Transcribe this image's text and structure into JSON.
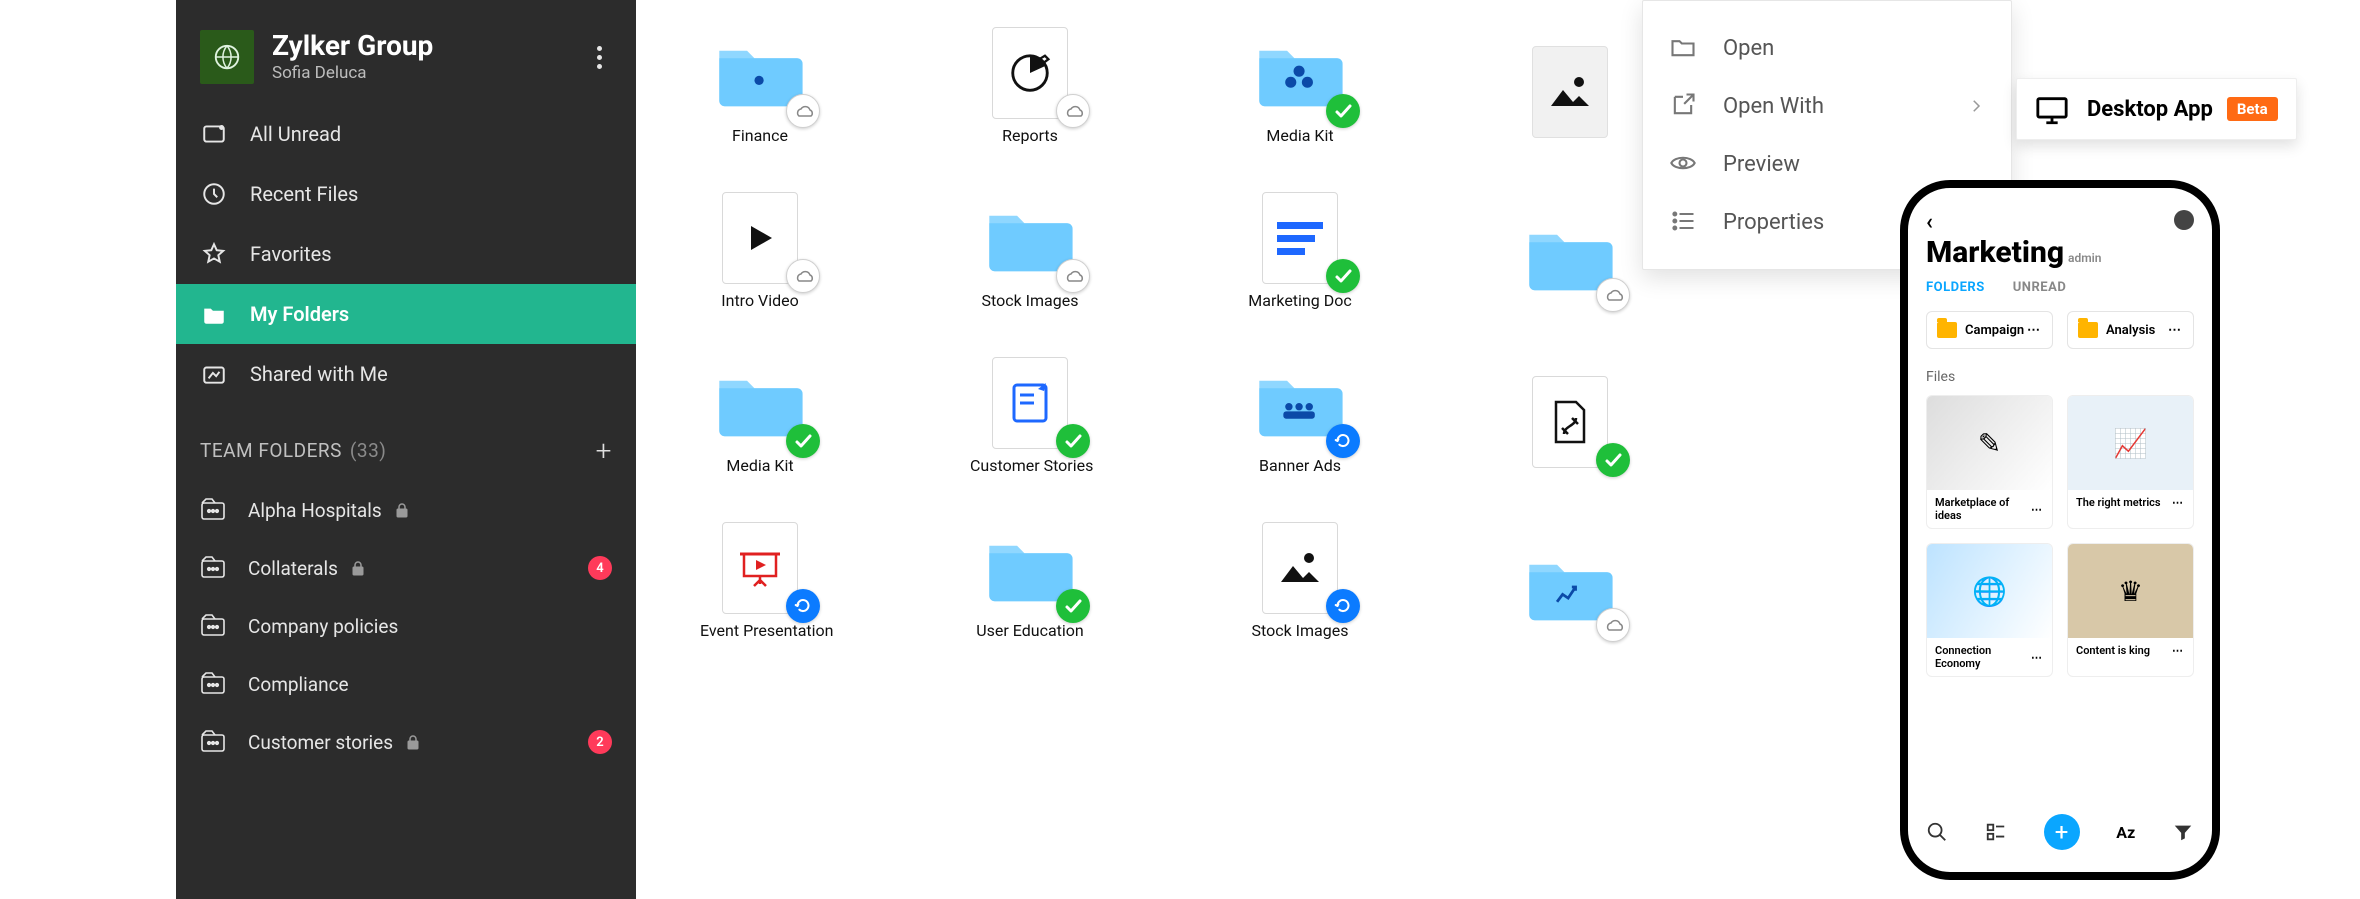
{
  "sidebar": {
    "org_name": "Zylker Group",
    "user_name": "Sofia Deluca",
    "nav": {
      "unread": "All Unread",
      "recent": "Recent Files",
      "favorites": "Favorites",
      "my_folders": "My Folders",
      "shared": "Shared with Me"
    },
    "team_section_label": "TEAM FOLDERS",
    "team_section_count": "(33)",
    "team_items": [
      {
        "label": "Alpha Hospitals",
        "locked": true,
        "badge": ""
      },
      {
        "label": "Collaterals",
        "locked": true,
        "badge": "4"
      },
      {
        "label": "Company policies",
        "locked": false,
        "badge": ""
      },
      {
        "label": "Compliance",
        "locked": false,
        "badge": ""
      },
      {
        "label": "Customer stories",
        "locked": true,
        "badge": "2"
      }
    ]
  },
  "files": {
    "row1": [
      {
        "label": "Finance",
        "type": "folder",
        "accent": "dot",
        "badge": "cloud"
      },
      {
        "label": "Reports",
        "type": "file",
        "accent": "pie",
        "badge": "cloud"
      },
      {
        "label": "Media Kit",
        "type": "folder",
        "accent": "tri",
        "badge": "ok"
      },
      {
        "label": "",
        "type": "file",
        "accent": "img",
        "badge": "",
        "selected": true
      }
    ],
    "row2": [
      {
        "label": "Intro Video",
        "type": "file",
        "accent": "play",
        "badge": "cloud"
      },
      {
        "label": "Stock Images",
        "type": "folder",
        "accent": "",
        "badge": "cloud"
      },
      {
        "label": "Marketing Doc",
        "type": "file",
        "accent": "lines",
        "badge": "ok"
      },
      {
        "label": "",
        "type": "folder",
        "accent": "",
        "badge": "cloud"
      }
    ],
    "row3": [
      {
        "label": "Media Kit",
        "type": "folder",
        "accent": "",
        "badge": "ok"
      },
      {
        "label": "Customer Stories",
        "type": "file",
        "accent": "note",
        "badge": "ok"
      },
      {
        "label": "Banner Ads",
        "type": "folder",
        "accent": "people",
        "badge": "sync"
      },
      {
        "label": "",
        "type": "file",
        "accent": "pdf",
        "badge": "ok"
      }
    ],
    "row4": [
      {
        "label": "Event Presentation",
        "type": "file",
        "accent": "present",
        "badge": "sync"
      },
      {
        "label": "User Education",
        "type": "folder",
        "accent": "",
        "badge": "ok"
      },
      {
        "label": "Stock Images",
        "type": "file",
        "accent": "img",
        "badge": "sync"
      },
      {
        "label": "",
        "type": "folder",
        "accent": "stats",
        "badge": "cloud"
      }
    ]
  },
  "context_menu": {
    "open": "Open",
    "open_with": "Open With",
    "preview": "Preview",
    "properties": "Properties"
  },
  "desktop_tag": {
    "label": "Desktop App",
    "badge": "Beta"
  },
  "phone": {
    "title": "Marketing",
    "role": "admin",
    "tab_folders": "FOLDERS",
    "tab_unread": "UNREAD",
    "chips": [
      {
        "label": "Campaign"
      },
      {
        "label": "Analysis"
      }
    ],
    "files_head": "Files",
    "cards": [
      {
        "label": "Marketplace of ideas"
      },
      {
        "label": "The right metrics"
      },
      {
        "label": "Connection Economy"
      },
      {
        "label": "Content is king"
      }
    ],
    "sort_label": "Az"
  },
  "colors": {
    "accent": "#22b68f",
    "folder": "#6fcbff",
    "sync": "#0b7bff",
    "ok": "#1fbf3a",
    "beta": "#ff6a13"
  }
}
